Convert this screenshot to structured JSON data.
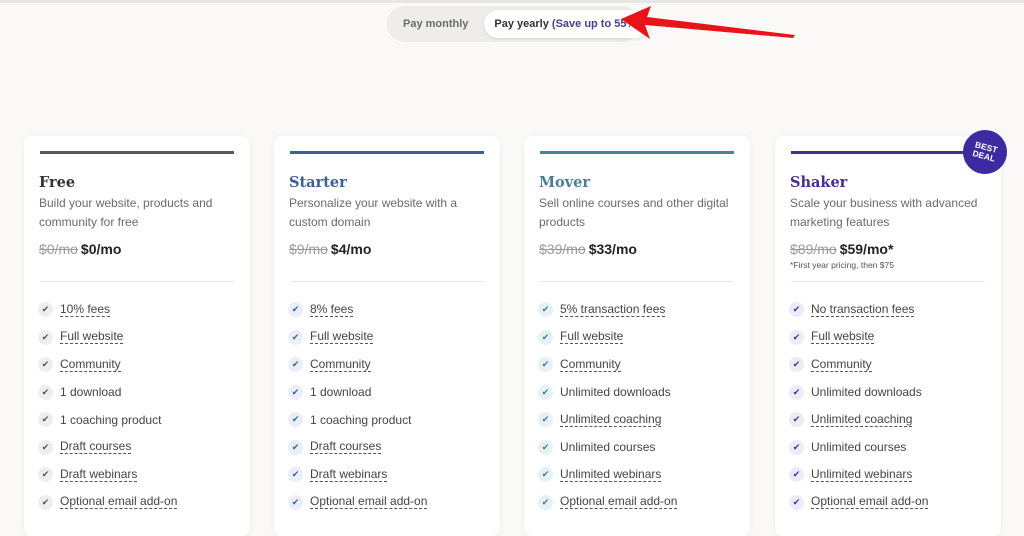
{
  "billing_toggle": {
    "monthly_label": "Pay monthly",
    "yearly_label": "Pay yearly",
    "yearly_savings": "(Save up to 55%)",
    "selected": "yearly"
  },
  "annotation": {
    "type": "arrow",
    "color": "#e8141a",
    "points_to": "yearly-option"
  },
  "plans": [
    {
      "name": "Free",
      "accent": "#5a5a5a",
      "name_color": "#333333",
      "check_color": "#555555",
      "check_bg": "#eeeeee",
      "description": "Build your website, products and community for free",
      "old_price": "$0/mo",
      "price": "$0/mo",
      "note": "",
      "features": [
        {
          "label": "10% fees",
          "dashed": true
        },
        {
          "label": "Full website",
          "dashed": true
        },
        {
          "label": "Community",
          "dashed": true
        },
        {
          "label": "1 download",
          "dashed": false
        },
        {
          "label": "1 coaching product",
          "dashed": false
        },
        {
          "label": "Draft courses",
          "dashed": true
        },
        {
          "label": "Draft webinars",
          "dashed": true
        },
        {
          "label": "Optional email add-on",
          "dashed": true
        }
      ]
    },
    {
      "name": "Starter",
      "accent": "#3d5f96",
      "name_color": "#3d5f96",
      "check_color": "#3d5f96",
      "check_bg": "#e9eef7",
      "description": "Personalize your website with a custom domain",
      "old_price": "$9/mo",
      "price": "$4/mo",
      "note": "",
      "features": [
        {
          "label": "8% fees",
          "dashed": true
        },
        {
          "label": "Full website",
          "dashed": true
        },
        {
          "label": "Community",
          "dashed": true
        },
        {
          "label": "1 download",
          "dashed": false
        },
        {
          "label": "1 coaching product",
          "dashed": false
        },
        {
          "label": "Draft courses",
          "dashed": true
        },
        {
          "label": "Draft webinars",
          "dashed": true
        },
        {
          "label": "Optional email add-on",
          "dashed": true
        }
      ]
    },
    {
      "name": "Mover",
      "accent": "#4a8296",
      "name_color": "#4a7f93",
      "check_color": "#3f7c91",
      "check_bg": "#e6f1f4",
      "description": "Sell online courses and other digital products",
      "old_price": "$39/mo",
      "price": "$33/mo",
      "note": "",
      "features": [
        {
          "label": "5% transaction fees",
          "dashed": true
        },
        {
          "label": "Full website",
          "dashed": true
        },
        {
          "label": "Community",
          "dashed": true
        },
        {
          "label": "Unlimited downloads",
          "dashed": false
        },
        {
          "label": "Unlimited coaching",
          "dashed": true
        },
        {
          "label": "Unlimited courses",
          "dashed": false
        },
        {
          "label": "Unlimited webinars",
          "dashed": true
        },
        {
          "label": "Optional email add-on",
          "dashed": true
        }
      ]
    },
    {
      "name": "Shaker",
      "accent": "#4a2f8e",
      "name_color": "#4a2f8e",
      "check_color": "#4a2f8e",
      "check_bg": "#eeeaf7",
      "description": "Scale your business with advanced marketing features",
      "old_price": "$89/mo",
      "price": "$59/mo*",
      "note": "*First year pricing, then $75",
      "badge": [
        "BEST",
        "DEAL"
      ],
      "features": [
        {
          "label": "No transaction fees",
          "dashed": true
        },
        {
          "label": "Full website",
          "dashed": true
        },
        {
          "label": "Community",
          "dashed": true
        },
        {
          "label": "Unlimited downloads",
          "dashed": false
        },
        {
          "label": "Unlimited coaching",
          "dashed": true
        },
        {
          "label": "Unlimited courses",
          "dashed": false
        },
        {
          "label": "Unlimited webinars",
          "dashed": true
        },
        {
          "label": "Optional email add-on",
          "dashed": true
        }
      ]
    }
  ]
}
